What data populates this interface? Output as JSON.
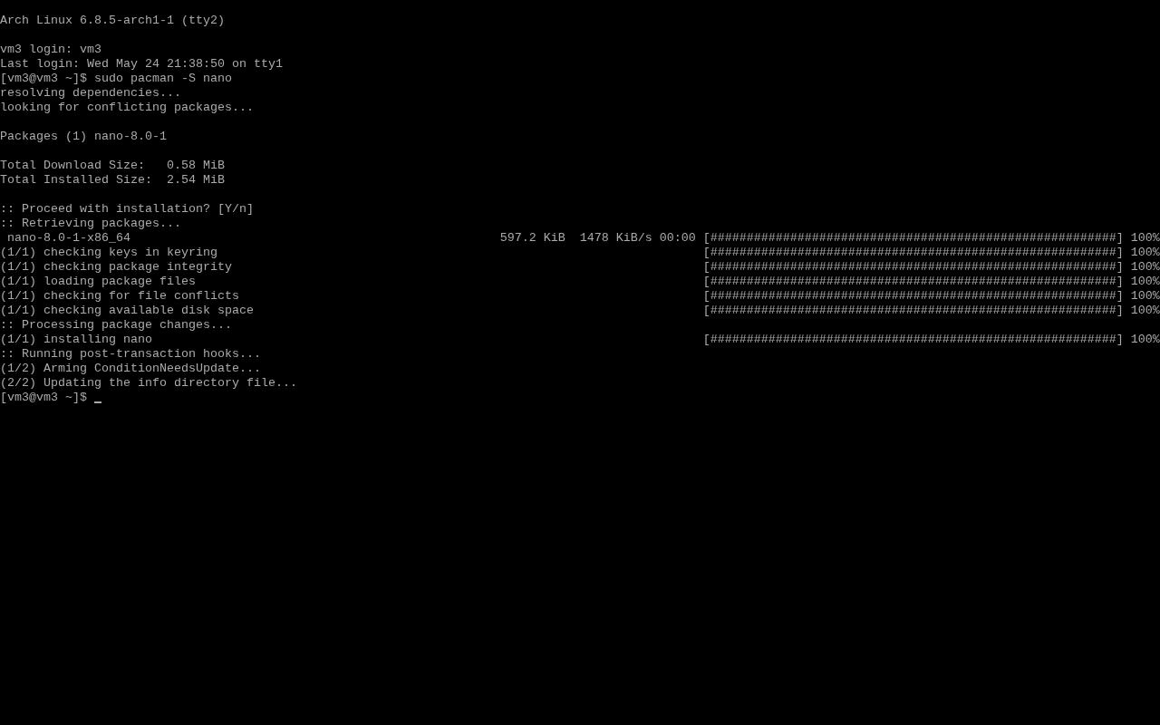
{
  "terminal": {
    "blocks": [
      [
        {
          "text": "Arch Linux 6.8.5-arch1-1 (tty2)"
        }
      ],
      [
        {
          "text": "vm3 login: vm3"
        },
        {
          "text": "Last login: Wed May 24 21:38:50 on tty1"
        },
        {
          "text": "[vm3@vm3 ~]$ sudo pacman -S nano"
        },
        {
          "text": "resolving dependencies..."
        },
        {
          "text": "looking for conflicting packages..."
        }
      ],
      [
        {
          "text": "Packages (1) nano-8.0-1"
        }
      ],
      [
        {
          "text": "Total Download Size:   0.58 MiB"
        },
        {
          "text": "Total Installed Size:  2.54 MiB"
        }
      ],
      [
        {
          "text": ":: Proceed with installation? [Y/n]"
        },
        {
          "text": ":: Retrieving packages..."
        },
        {
          "text": " nano-8.0-1-x86_64",
          "stats": "597.2 KiB  1478 KiB/s 00:00",
          "bar": "[########################################################]",
          "percent": "100%"
        },
        {
          "text": "(1/1) checking keys in keyring",
          "bar": "[########################################################]",
          "percent": "100%"
        },
        {
          "text": "(1/1) checking package integrity",
          "bar": "[########################################################]",
          "percent": "100%"
        },
        {
          "text": "(1/1) loading package files",
          "bar": "[########################################################]",
          "percent": "100%"
        },
        {
          "text": "(1/1) checking for file conflicts",
          "bar": "[########################################################]",
          "percent": "100%"
        },
        {
          "text": "(1/1) checking available disk space",
          "bar": "[########################################################]",
          "percent": "100%"
        },
        {
          "text": ":: Processing package changes..."
        },
        {
          "text": "(1/1) installing nano",
          "bar": "[########################################################]",
          "percent": "100%"
        },
        {
          "text": ":: Running post-transaction hooks..."
        },
        {
          "text": "(1/2) Arming ConditionNeedsUpdate..."
        },
        {
          "text": "(2/2) Updating the info directory file..."
        },
        {
          "text": "[vm3@vm3 ~]$",
          "cursor": true
        }
      ]
    ]
  }
}
